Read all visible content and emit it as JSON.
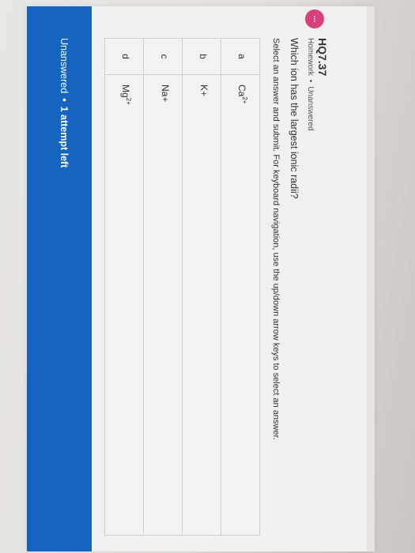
{
  "header": {
    "badge_text": "...",
    "title": "HQ7.37",
    "category": "Homework",
    "separator": "•",
    "status": "Unanswered"
  },
  "question": {
    "text": "Which ion has the largest ionic radii?",
    "instruction": "Select an answer and submit. For keyboard navigation, use the up/down arrow keys to select an answer."
  },
  "options": [
    {
      "letter": "a",
      "ion": "Ca",
      "charge": "2+",
      "suffix": ""
    },
    {
      "letter": "b",
      "ion": "K+",
      "charge": "",
      "suffix": ""
    },
    {
      "letter": "c",
      "ion": "Na+",
      "charge": "",
      "suffix": ""
    },
    {
      "letter": "d",
      "ion": "Mg",
      "charge": "2+",
      "suffix": ""
    }
  ],
  "footer": {
    "status": "Unanswered",
    "separator": "•",
    "attempts": "1 attempt left"
  },
  "colors": {
    "badge": "#d9417a",
    "status_bar": "#1565c0"
  }
}
